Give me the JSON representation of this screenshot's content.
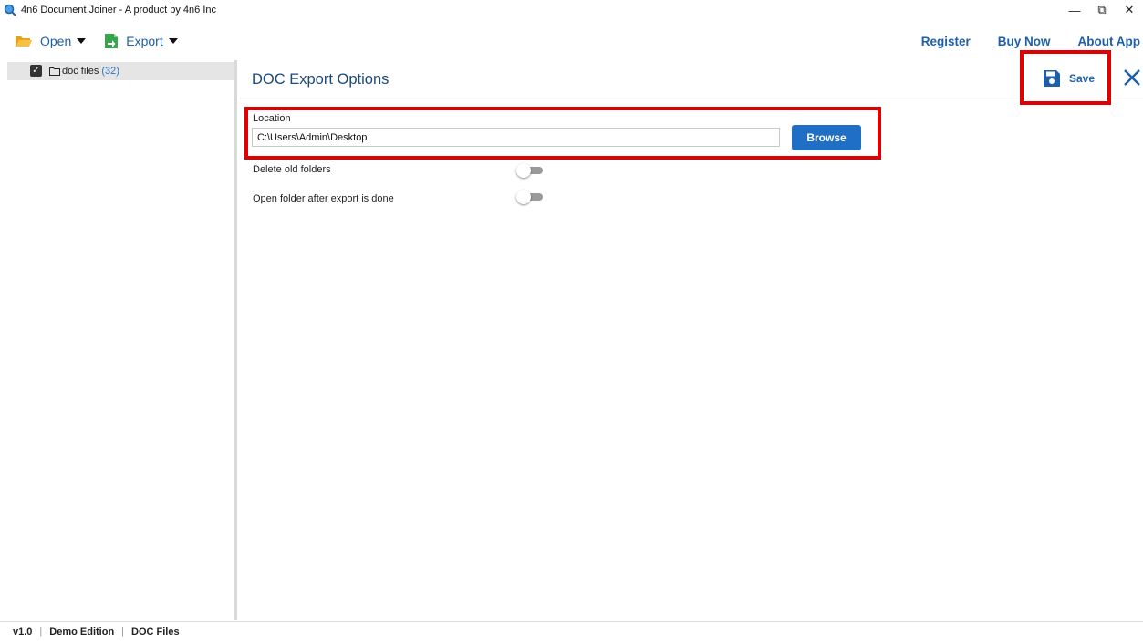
{
  "window": {
    "title": "4n6 Document Joiner - A product by 4n6 Inc",
    "controls": {
      "minimize": "—",
      "restore": "⧉",
      "close": "✕"
    }
  },
  "toolbar": {
    "open_label": "Open",
    "export_label": "Export",
    "register_label": "Register",
    "buy_now_label": "Buy Now",
    "about_label": "About App"
  },
  "tree": {
    "items": [
      {
        "label": "doc files",
        "count": "(32)",
        "checked": true
      }
    ]
  },
  "panel": {
    "title": "DOC Export Options",
    "save_label": "Save",
    "location_label": "Location",
    "location_value": "C:\\Users\\Admin\\Desktop",
    "browse_label": "Browse",
    "options": [
      {
        "label": "Delete old folders",
        "enabled": false
      },
      {
        "label": "Open folder after export is done",
        "enabled": false
      }
    ]
  },
  "status": {
    "version": "v1.0",
    "edition": "Demo Edition",
    "mode": "DOC Files",
    "separator": "|"
  },
  "colors": {
    "accent": "#1e5fa8",
    "button": "#1f6fc6",
    "highlight": "#e00000",
    "count": "#2f74c0"
  }
}
